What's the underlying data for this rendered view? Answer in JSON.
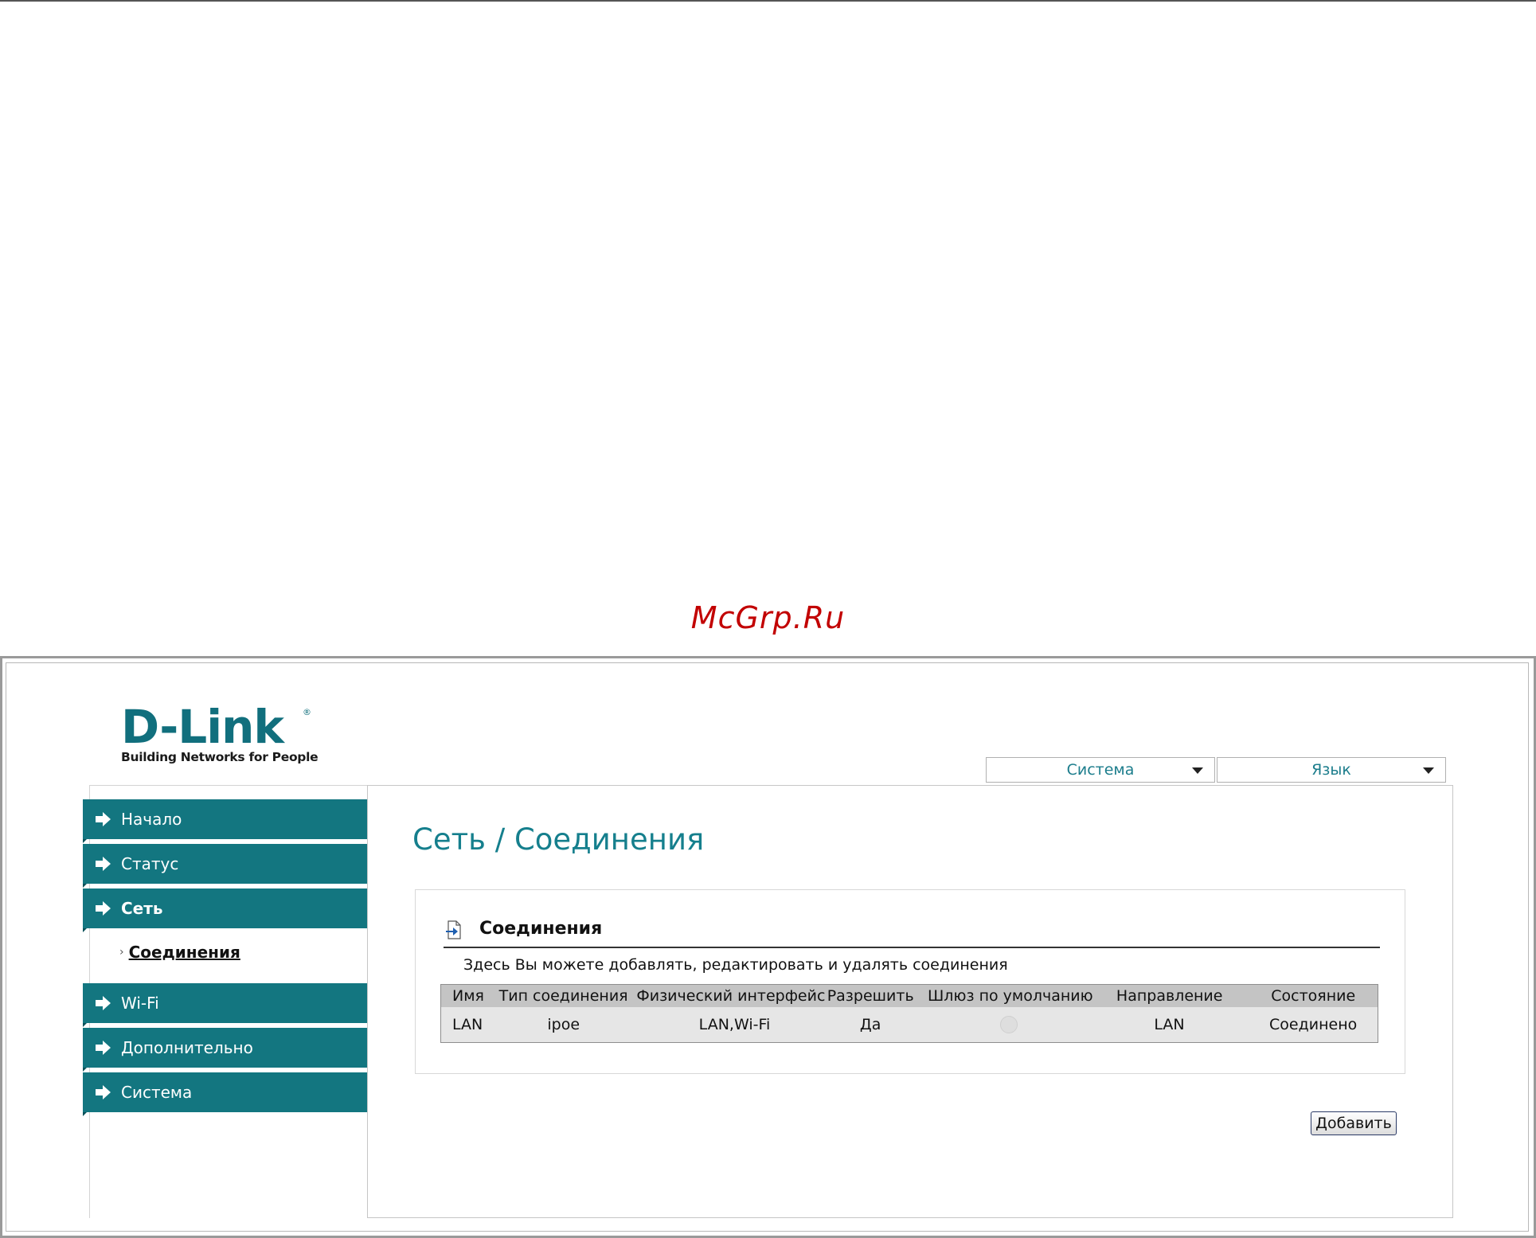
{
  "watermark": "McGrp.Ru",
  "brand": {
    "name": "D-Link",
    "reg": "®",
    "tagline": "Building Networks for People"
  },
  "header": {
    "system_dropdown": "Система",
    "language_dropdown": "Язык"
  },
  "sidebar": {
    "items": [
      {
        "label": "Начало"
      },
      {
        "label": "Статус"
      },
      {
        "label": "Сеть"
      },
      {
        "label": "Wi-Fi"
      },
      {
        "label": "Дополнительно"
      },
      {
        "label": "Система"
      }
    ],
    "sub_item": {
      "bullet": "›",
      "label": "Соединения"
    }
  },
  "main": {
    "title": "Сеть / Соединения",
    "panel": {
      "title": "Соединения",
      "description": "Здесь Вы можете добавлять, редактировать и удалять соединения",
      "table": {
        "headers": [
          "Имя",
          "Тип соединения",
          "Физический интерфейс",
          "Разрешить",
          "Шлюз по умолчанию",
          "Направление",
          "Состояние"
        ],
        "rows": [
          {
            "name": "LAN",
            "type": "ipoe",
            "phys": "LAN,Wi-Fi",
            "allow": "Да",
            "gateway": "",
            "direction": "LAN",
            "state": "Соединено"
          }
        ]
      }
    },
    "add_button": "Добавить"
  },
  "colors": {
    "accent": "#137680",
    "title_teal": "#157f8d",
    "watermark_red": "#c20000"
  }
}
